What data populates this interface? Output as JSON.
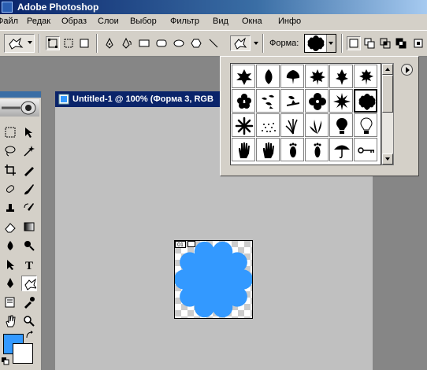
{
  "app": {
    "title": "Adobe Photoshop"
  },
  "menu": {
    "items": [
      "Файл",
      "Редак",
      "Образ",
      "Слои",
      "Выбор",
      "Фильтр",
      "Вид",
      "Окна",
      "Инфо"
    ]
  },
  "options_bar": {
    "shape_label": "Форма:"
  },
  "document": {
    "title": "Untitled-1 @ 100% (Форма 3, RGB",
    "layer_badge": "01",
    "fill_color": "#3399ff"
  },
  "shape_picker": {
    "shapes": [
      "leaf-icon",
      "teardrop-leaf-icon",
      "maple-leaf-icon",
      "maple-leaf-2-icon",
      "maple-leaf-3-icon",
      "maple-leaf-4-icon",
      "blossom-icon",
      "birds-icon",
      "bird-branch-icon",
      "flower-icon",
      "starburst-icon",
      "scalloped-flower-icon",
      "flower-burst-icon",
      "grass-dots-icon",
      "grass-icon",
      "grass-leaves-icon",
      "lightbulb-icon",
      "lightbulb-outline-icon",
      "hand-icon",
      "hand-2-icon",
      "footprint-icon",
      "footprint-2-icon",
      "umbrella-icon",
      "key-icon"
    ],
    "selected_index": 11
  },
  "colors": {
    "foreground": "#3399ff",
    "background": "#ffffff",
    "title_bar": "#0a246a",
    "panel": "#d4d0c8"
  }
}
